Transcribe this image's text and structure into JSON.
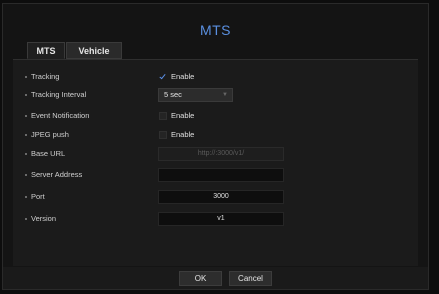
{
  "dialog": {
    "title": "MTS"
  },
  "tabs": [
    {
      "label": "MTS",
      "active": true
    },
    {
      "label": "Vehicle",
      "active": false
    }
  ],
  "fields": {
    "tracking": {
      "label": "Tracking",
      "checked": true,
      "option_label": "Enable"
    },
    "tracking_interval": {
      "label": "Tracking Interval",
      "value": "5 sec"
    },
    "event_notification": {
      "label": "Event Notification",
      "checked": false,
      "option_label": "Enable"
    },
    "jpeg_push": {
      "label": "JPEG push",
      "checked": false,
      "option_label": "Enable"
    },
    "base_url": {
      "label": "Base URL",
      "value": "http://:3000/v1/"
    },
    "server_address": {
      "label": "Server Address",
      "value": ""
    },
    "port": {
      "label": "Port",
      "value": "3000"
    },
    "version": {
      "label": "Version",
      "value": "v1"
    }
  },
  "buttons": {
    "ok": "OK",
    "cancel": "Cancel"
  },
  "colors": {
    "accent": "#5a8fe0",
    "background": "#141414"
  }
}
